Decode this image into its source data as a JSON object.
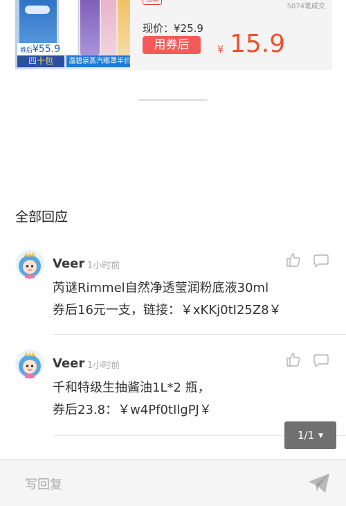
{
  "product": {
    "tag": "包邮",
    "sold": "5074笔成交",
    "current_price": "现价：¥25.9",
    "coupon_label": "用券后",
    "currency": "¥",
    "final_price": "15.9",
    "image": {
      "price_prefix": "券后",
      "price_badge": "¥55.9",
      "pack_badge": "四十包",
      "promo": "温碧泉蒸汽眼罩半价"
    }
  },
  "section_title": "全部回应",
  "comments": [
    {
      "author": "Veer",
      "time": "1小时前",
      "line1": "芮谜Rimmel自然净透莹润粉底液30ml",
      "line2": "券后16元一支，链接：￥xKKj0tI25Z8￥"
    },
    {
      "author": "Veer",
      "time": "1小时前",
      "line1": "千和特级生抽酱油1L*2 瓶，",
      "line2": "券后23.8：￥w4Pf0tIlgPJ￥"
    }
  ],
  "pager": {
    "label": "1/1",
    "caret": "▼"
  },
  "reply_bar": {
    "placeholder": "写回复"
  },
  "icons": {
    "like": "thumbs-up-icon",
    "reply": "speech-bubble-icon",
    "send": "paper-plane-icon",
    "avatar": "princess-avatar"
  },
  "colors": {
    "accent": "#f04f2c",
    "coupon": "#f45a5a",
    "pager_bg": "#707070"
  }
}
